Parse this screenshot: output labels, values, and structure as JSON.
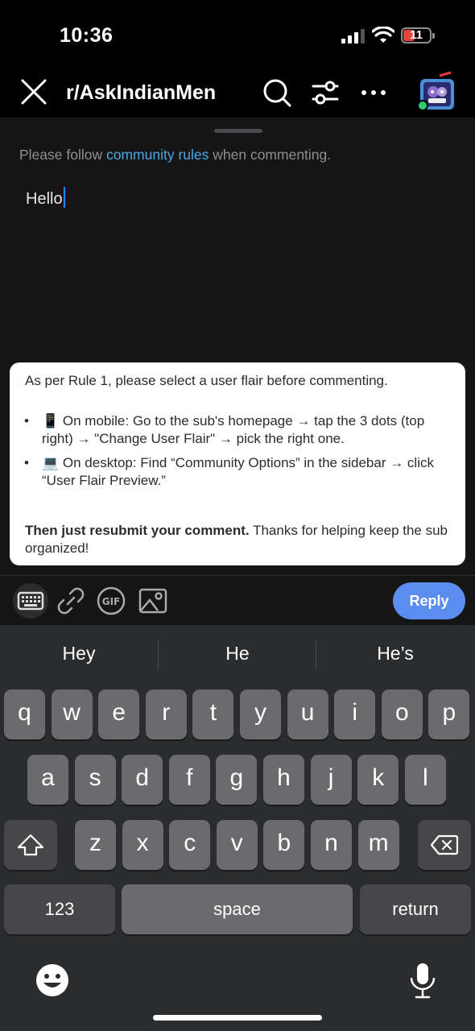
{
  "status_bar": {
    "time": "10:36",
    "battery": "11"
  },
  "header": {
    "title": "r/AskIndianMen"
  },
  "composer": {
    "rules_prefix": "Please follow ",
    "rules_link": "community rules",
    "rules_suffix": " when commenting.",
    "comment_text": "Hello"
  },
  "notice": {
    "intro": "As per Rule 1, please select a user flair before commenting.",
    "bullet": "•",
    "items": [
      {
        "emoji": "📱",
        "text": "On mobile: Go to the sub's homepage → tap the 3 dots (top right) → \"Change User Flair\" → pick the right one."
      },
      {
        "emoji": "💻",
        "text": "On desktop: Find “Community Options” in the sidebar → click “User Flair Preview.”"
      }
    ],
    "closing_bold": "Then just resubmit your comment.",
    "closing_rest": " Thanks for helping keep the sub organized!"
  },
  "toolbar": {
    "reply_label": "Reply",
    "gif_label": "GIF"
  },
  "keyboard": {
    "suggestions": [
      "Hey",
      "He",
      "He’s"
    ],
    "row1": [
      "q",
      "w",
      "e",
      "r",
      "t",
      "y",
      "u",
      "i",
      "o",
      "p"
    ],
    "row2": [
      "a",
      "s",
      "d",
      "f",
      "g",
      "h",
      "j",
      "k",
      "l"
    ],
    "row3": [
      "z",
      "x",
      "c",
      "v",
      "b",
      "n",
      "m"
    ],
    "numbers_label": "123",
    "space_label": "space",
    "return_label": "return"
  }
}
